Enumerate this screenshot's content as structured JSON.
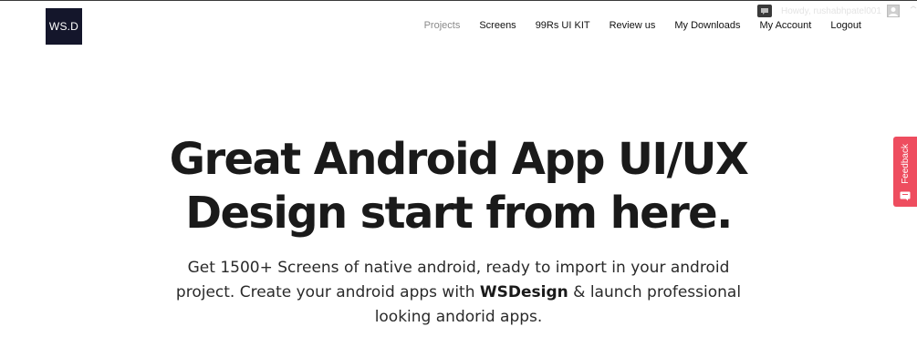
{
  "brand": {
    "logo_text": "WS.D"
  },
  "admin_bar": {
    "greeting": "Howdy, rushabhpatel001"
  },
  "nav": {
    "items": [
      {
        "label": "Projects",
        "active": true
      },
      {
        "label": "Screens"
      },
      {
        "label": "99Rs UI KIT"
      },
      {
        "label": "Review us"
      },
      {
        "label": "My Downloads"
      },
      {
        "label": "My Account"
      },
      {
        "label": "Logout"
      }
    ]
  },
  "hero": {
    "title_line1": "Great Android App UI/UX",
    "title_line2": "Design start from here.",
    "subtitle_part1": "Get 1500+ Screens of native android, ready to import in your android project. Create your android apps with ",
    "subtitle_brand": "WSDesign",
    "subtitle_part2": " & launch professional looking andorid apps."
  },
  "feedback_tab": {
    "label": "Feedback"
  },
  "colors": {
    "logo_bg": "#14162b",
    "feedback_bg": "#ee4d5f",
    "nav_active": "#8a8a8a",
    "text": "#1a1a1a"
  },
  "icons": [
    "chat-icon",
    "avatar-icon",
    "feedback-icon"
  ]
}
